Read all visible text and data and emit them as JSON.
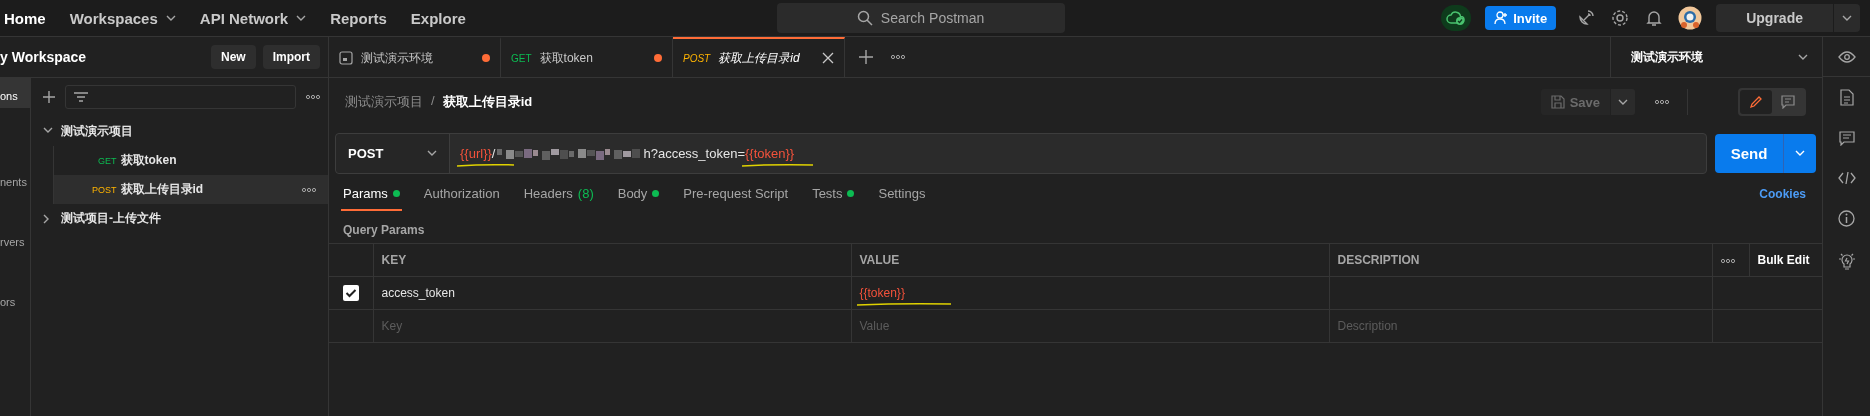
{
  "top_nav": {
    "menu": [
      {
        "label": "Home",
        "dropdown": false
      },
      {
        "label": "Workspaces",
        "dropdown": true
      },
      {
        "label": "API Network",
        "dropdown": true
      },
      {
        "label": "Reports",
        "dropdown": false
      },
      {
        "label": "Explore",
        "dropdown": false
      }
    ],
    "search": {
      "placeholder": "Search Postman"
    },
    "invite": "Invite",
    "upgrade": "Upgrade"
  },
  "workspace": {
    "title": "y Workspace",
    "buttons": [
      "New",
      "Import"
    ]
  },
  "sidebar_rail": [
    {
      "label": "ons",
      "selected": true
    },
    {
      "label": "nents",
      "selected": false
    },
    {
      "label": "rvers",
      "selected": false
    },
    {
      "label": "ors",
      "selected": false
    }
  ],
  "collections": [
    {
      "name": "测试演示项目",
      "expanded": true,
      "children": [
        {
          "method": "GET",
          "name": "获取token",
          "selected": false
        },
        {
          "method": "POST",
          "name": "获取上传目录id",
          "selected": true
        }
      ]
    },
    {
      "name": "测试项目-上传文件",
      "expanded": false
    }
  ],
  "tabs": [
    {
      "kind": "environment",
      "label": "测试演示环境",
      "unsaved": true,
      "selected": false
    },
    {
      "kind": "request",
      "method": "GET",
      "label": "获取token",
      "unsaved": true,
      "selected": false
    },
    {
      "kind": "request",
      "method": "POST",
      "label": "获取上传目录id",
      "unsaved": false,
      "selected": true
    }
  ],
  "environment": {
    "label": "测试演示环境"
  },
  "breadcrumb": {
    "separator": "/",
    "items": [
      "测试演示项目",
      "获取上传目录id"
    ]
  },
  "save": {
    "label": "Save",
    "disabled": true
  },
  "view_mode": [
    {
      "kind": "edit",
      "selected": true
    },
    {
      "kind": "comments",
      "selected": false
    }
  ],
  "request": {
    "method": "POST",
    "url": [
      {
        "kind": "variable",
        "text": "{{url}}",
        "marked": true
      },
      {
        "kind": "plain",
        "text": "/"
      },
      {
        "kind": "redacted"
      },
      {
        "kind": "plain",
        "text": "h?access_token="
      },
      {
        "kind": "variable",
        "text": "{{token}}",
        "marked": true
      }
    ],
    "send": "Send"
  },
  "request_tabs": [
    {
      "label": "Params",
      "dot": true,
      "selected": true
    },
    {
      "label": "Authorization",
      "dot": false,
      "selected": false
    },
    {
      "label": "Headers",
      "count": "(8)",
      "dot": false,
      "selected": false
    },
    {
      "label": "Body",
      "dot": true,
      "selected": false
    },
    {
      "label": "Pre-request Script",
      "dot": false,
      "selected": false
    },
    {
      "label": "Tests",
      "dot": true,
      "selected": false
    },
    {
      "label": "Settings",
      "dot": false,
      "selected": false
    }
  ],
  "cookies": "Cookies",
  "section_title": "Query Params",
  "params_table": {
    "columns": [
      "KEY",
      "VALUE",
      "DESCRIPTION"
    ],
    "bulk_edit": "Bulk Edit",
    "rows": [
      {
        "checked": true,
        "key": "access_token",
        "value": "{{token}}",
        "value_marked": true
      }
    ],
    "new_row": {
      "key_placeholder": "Key",
      "value_placeholder": "Value",
      "description_placeholder": "Description"
    }
  }
}
